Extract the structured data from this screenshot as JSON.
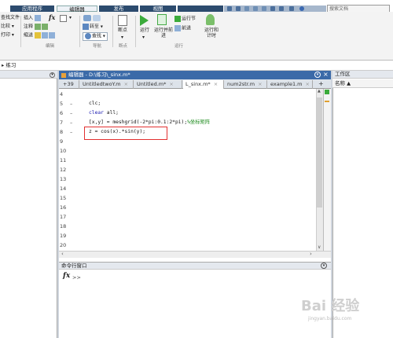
{
  "tabs": [
    "应用程序",
    "编辑器",
    "发布",
    "视图"
  ],
  "search_placeholder": "搜索文档",
  "ribbon": {
    "file": {
      "find_files": "查找文件",
      "compare": "比较",
      "print": "打印"
    },
    "edit": {
      "insert": "插入",
      "fx": "fx",
      "comment": "注释",
      "indent": "缩进"
    },
    "navigate": {
      "goto": "转至",
      "find": "查找"
    },
    "breakpoints": {
      "label": "断点"
    },
    "run": {
      "run": "运行",
      "run_advance": "运行并前进",
      "run_section": "运行节",
      "advance": "前进",
      "run_time": "运行和计时"
    },
    "sections": [
      "编辑",
      "导航",
      "断点",
      "运行"
    ]
  },
  "path_bar": "▸ 练习",
  "editor": {
    "title": "编辑器 - D:\\练习\\_sinx.m*",
    "tabs": [
      {
        "label": "+39",
        "active": false
      },
      {
        "label": "UntitledtwoY.m",
        "active": false
      },
      {
        "label": "Untitled.m*",
        "active": false
      },
      {
        "label": "L_sinx.m*",
        "active": true
      },
      {
        "label": "num2str.m",
        "active": false
      },
      {
        "label": "example1.m",
        "active": false
      }
    ],
    "line_numbers": [
      "4",
      "5",
      "6",
      "7",
      "8",
      "9",
      "10",
      "11",
      "12",
      "13",
      "14",
      "15",
      "16",
      "17",
      "18",
      "19",
      "20",
      "21"
    ],
    "code": {
      "l5": "clc;",
      "l6_kw": "clear",
      "l6_rest": " all;",
      "l7_code": "[x,y] = meshgrid(-2*pi:0.1:2*pi);",
      "l7_comment": "%坐标矩阵",
      "l8": "z = cos(x).*sin(y);"
    }
  },
  "command_window": {
    "title": "命令行窗口",
    "prompt_fx": "fx",
    "prompt_arrow": ">>"
  },
  "workspace": {
    "title": "工作区",
    "col_name": "名称 ▲"
  },
  "watermark": {
    "brand": "Bai 经验",
    "url": "jingyan.baidu.com"
  }
}
